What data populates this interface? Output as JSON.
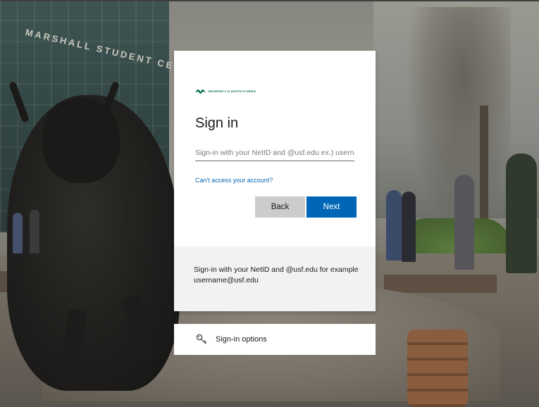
{
  "background": {
    "building_sign": "MARSHALL STUDENT CENTER"
  },
  "login": {
    "logo_text": "UNIVERSITY of SOUTH FLORIDA",
    "title": "Sign in",
    "input_placeholder": "Sign-in with your NetID and @usf.edu ex.) usernam",
    "input_value": "",
    "cant_access_link": "Can't access your account?",
    "back_label": "Back",
    "next_label": "Next",
    "hint_text": "Sign-in with your NetID and @usf.edu for example username@usf.edu"
  },
  "options": {
    "label": "Sign-in options",
    "icon": "key-icon"
  },
  "colors": {
    "accent": "#0067b8",
    "brand": "#006747",
    "back_button": "#cccccc",
    "hint_panel": "#f2f2f2"
  }
}
